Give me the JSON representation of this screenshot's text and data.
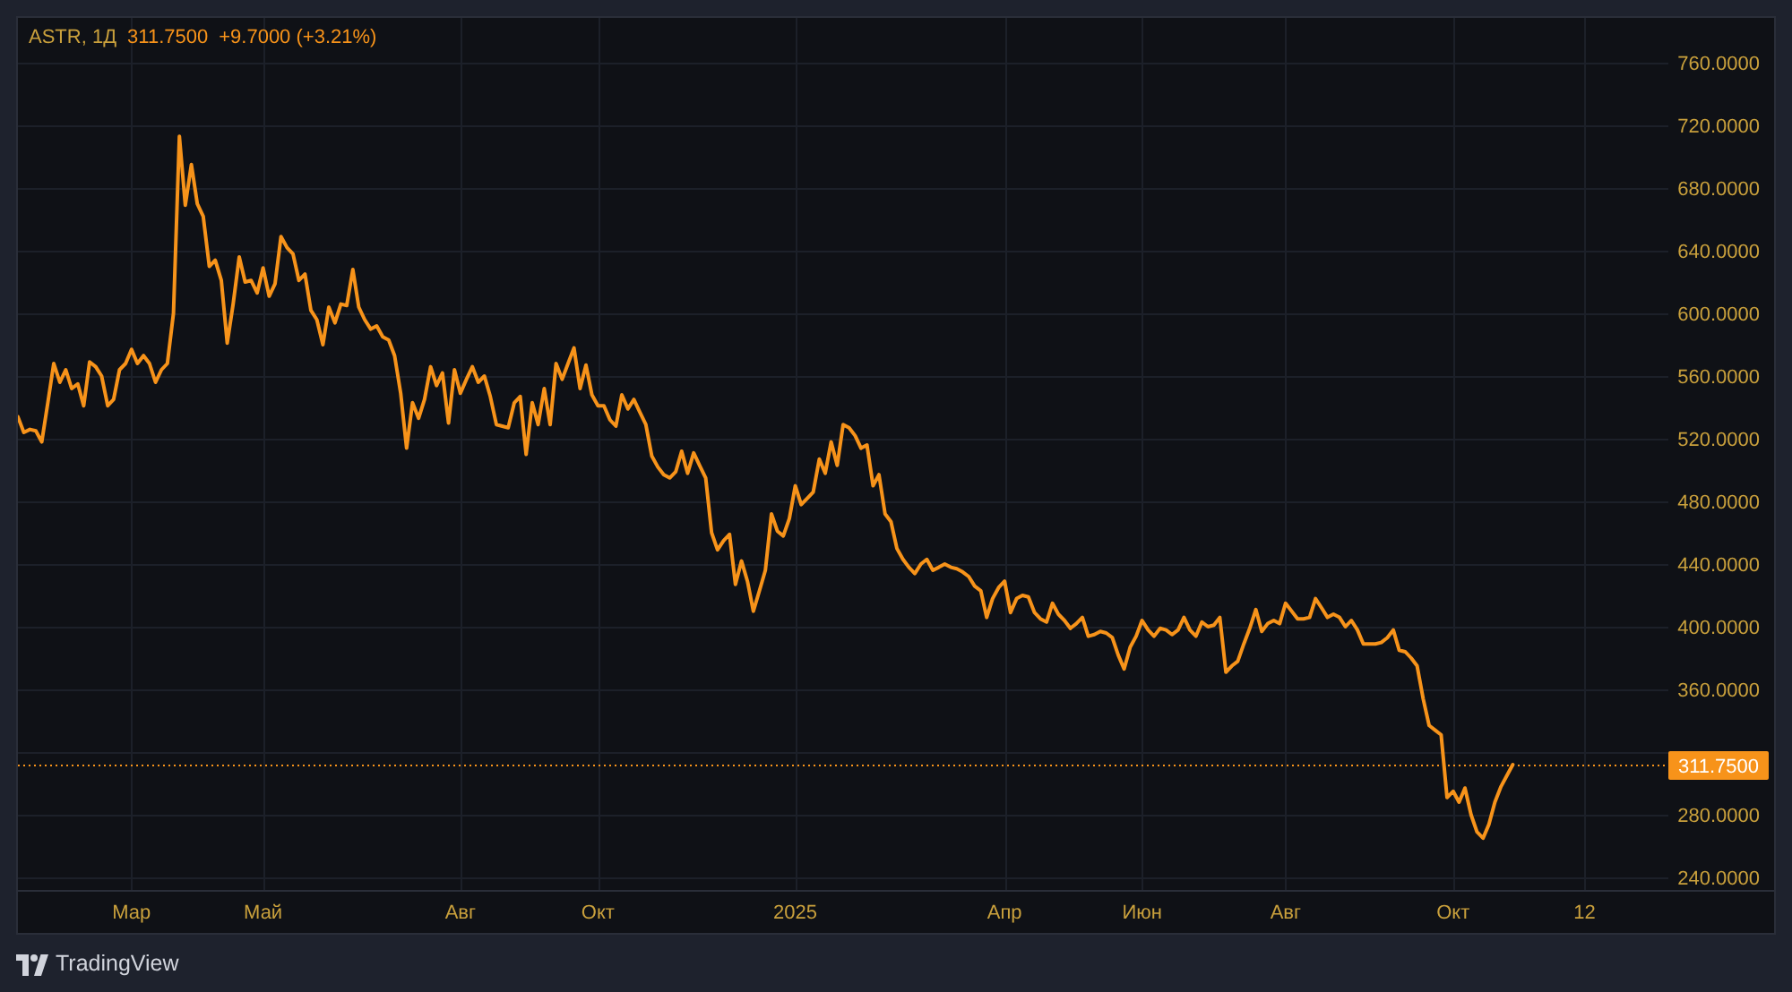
{
  "chart": {
    "legend": {
      "symbol": "ASTR, 1Д",
      "last": "311.7500",
      "change": "+9.7000 (+3.21%)"
    },
    "chart_data": {
      "type": "line",
      "grid": true,
      "categories": [
        null,
        null,
        null,
        null,
        null,
        null,
        null,
        null,
        null,
        null,
        null,
        null,
        null,
        null,
        null,
        null,
        null,
        null,
        null,
        "Мар",
        null,
        null,
        null,
        null,
        null,
        null,
        null,
        null,
        null,
        null,
        null,
        null,
        null,
        null,
        null,
        null,
        null,
        null,
        null,
        null,
        null,
        "Май",
        null,
        null,
        null,
        null,
        null,
        null,
        null,
        null,
        null,
        null,
        null,
        null,
        null,
        null,
        null,
        null,
        null,
        null,
        null,
        null,
        null,
        null,
        null,
        null,
        null,
        null,
        null,
        null,
        null,
        null,
        null,
        null,
        "Авг",
        null,
        null,
        null,
        null,
        null,
        null,
        null,
        null,
        null,
        null,
        null,
        null,
        null,
        null,
        null,
        null,
        null,
        null,
        null,
        null,
        null,
        null,
        "Окт",
        null,
        null,
        null,
        null,
        null,
        null,
        null,
        null,
        null,
        null,
        null,
        null,
        null,
        null,
        null,
        null,
        null,
        null,
        null,
        null,
        null,
        null,
        null,
        null,
        null,
        null,
        null,
        null,
        null,
        null,
        null,
        null,
        "2025",
        null,
        null,
        null,
        null,
        null,
        null,
        null,
        null,
        null,
        null,
        null,
        null,
        null,
        null,
        null,
        null,
        null,
        null,
        null,
        null,
        null,
        null,
        null,
        null,
        null,
        null,
        null,
        null,
        null,
        null,
        null,
        null,
        null,
        null,
        "Апр",
        null,
        null,
        null,
        null,
        null,
        null,
        null,
        null,
        null,
        null,
        null,
        null,
        null,
        null,
        null,
        null,
        null,
        null,
        null,
        null,
        null,
        null,
        "Июн",
        null,
        null,
        null,
        null,
        null,
        null,
        null,
        null,
        null,
        null,
        null,
        null,
        null,
        null,
        null,
        null,
        null,
        null,
        null,
        null,
        null,
        null,
        null,
        "Авг",
        null,
        null,
        null,
        null,
        null,
        null,
        null,
        null,
        null,
        null,
        null,
        null,
        null,
        null,
        null,
        null,
        null,
        null,
        null,
        null,
        null,
        null,
        null,
        null,
        null,
        null,
        null,
        "Окт",
        null,
        null,
        null,
        null,
        null,
        null,
        null,
        null,
        null,
        null,
        null,
        null,
        null,
        null,
        null,
        null,
        null,
        null,
        null,
        null,
        null,
        "12",
        null,
        null,
        null,
        null,
        null,
        null,
        null,
        null,
        null,
        null,
        null,
        null,
        null,
        null
      ],
      "series": [
        {
          "color": "#f7931a",
          "values": [
            534,
            524,
            526,
            525,
            518,
            543,
            568,
            556,
            564,
            552,
            555,
            541,
            569,
            566,
            560,
            541,
            545,
            564,
            568,
            577,
            568,
            573,
            568,
            556,
            564,
            568,
            600,
            713,
            669,
            695,
            670,
            662,
            630,
            634,
            621,
            581,
            606,
            636,
            620,
            621,
            613,
            629,
            611,
            619,
            649,
            642,
            638,
            621,
            625,
            602,
            596,
            580,
            604,
            594,
            606,
            605,
            628,
            604,
            596,
            590,
            592,
            585,
            583,
            573,
            549,
            514,
            543,
            533,
            545,
            566,
            554,
            562,
            530,
            564,
            549,
            558,
            566,
            556,
            560,
            547,
            529,
            528,
            527,
            543,
            547,
            510,
            543,
            529,
            552,
            529,
            568,
            558,
            568,
            578,
            552,
            567,
            548,
            541,
            541,
            532,
            528,
            548,
            539,
            545,
            537,
            529,
            509,
            502,
            497,
            495,
            499,
            512,
            498,
            511,
            503,
            495,
            460,
            449,
            455,
            459,
            427,
            442,
            429,
            410,
            423,
            436,
            472,
            461,
            458,
            469,
            490,
            478,
            482,
            486,
            507,
            498,
            518,
            503,
            529,
            527,
            522,
            514,
            516,
            490,
            497,
            472,
            467,
            450,
            443,
            438,
            434,
            440,
            443,
            436,
            438,
            440,
            438,
            437,
            435,
            432,
            426,
            423,
            406,
            418,
            425,
            429,
            409,
            418,
            420,
            419,
            409,
            405,
            403,
            415,
            408,
            404,
            399,
            402,
            406,
            394,
            395,
            397,
            396,
            393,
            382,
            373,
            387,
            394,
            404,
            398,
            394,
            399,
            398,
            395,
            398,
            406,
            398,
            394,
            403,
            400,
            401,
            406,
            371,
            375,
            378,
            389,
            399,
            411,
            397,
            402,
            404,
            402,
            415,
            410,
            405,
            405,
            406,
            418,
            412,
            406,
            408,
            406,
            400,
            404,
            398,
            389,
            389,
            389,
            390,
            393,
            398,
            385,
            384,
            380,
            375,
            354,
            337,
            334,
            331,
            291,
            295,
            288,
            297,
            280,
            269,
            265,
            274,
            288,
            298,
            305,
            312,
            null,
            null,
            null,
            null,
            null,
            null,
            null,
            null,
            null,
            null,
            null,
            null,
            null,
            null,
            null,
            null,
            null,
            null,
            null,
            null,
            null,
            null,
            null,
            null,
            null,
            null
          ]
        }
      ],
      "ylim": [
        232,
        788.6
      ],
      "yticks": [
        {
          "value": 240,
          "label": "240.0000"
        },
        {
          "value": 280,
          "label": "280.0000"
        },
        {
          "value": 360,
          "label": "360.0000"
        },
        {
          "value": 400,
          "label": "400.0000"
        },
        {
          "value": 440,
          "label": "440.0000"
        },
        {
          "value": 480,
          "label": "480.0000"
        },
        {
          "value": 520,
          "label": "520.0000"
        },
        {
          "value": 560,
          "label": "560.0000"
        },
        {
          "value": 600,
          "label": "600.0000"
        },
        {
          "value": 640,
          "label": "640.0000"
        },
        {
          "value": 680,
          "label": "680.0000"
        },
        {
          "value": 720,
          "label": "720.0000"
        },
        {
          "value": 760,
          "label": "760.0000"
        }
      ],
      "ref_lines": [
        {
          "axis": "y",
          "value": 311.75,
          "label": "311.7500"
        }
      ]
    }
  },
  "branding": {
    "name": "TradingView"
  }
}
